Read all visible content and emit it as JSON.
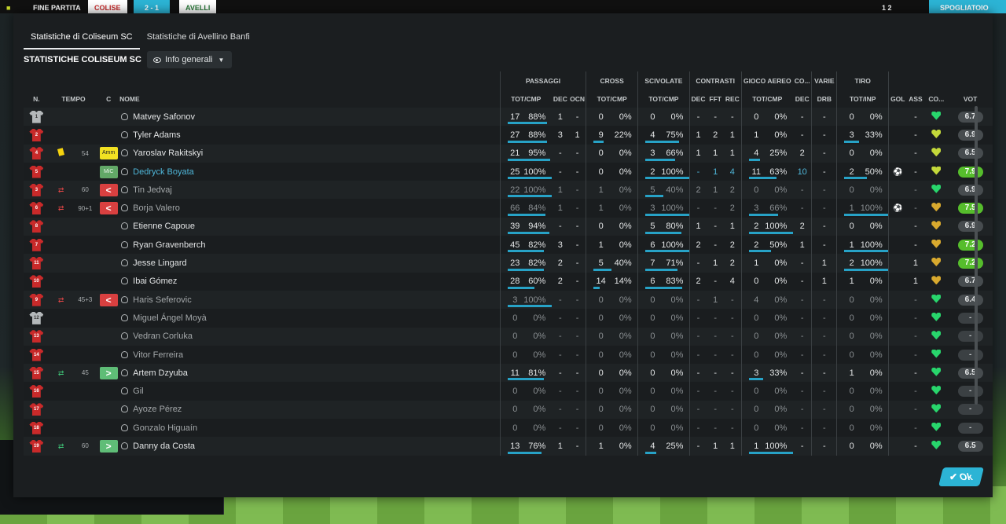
{
  "topbar": {
    "label": "FINE PARTITA",
    "home": "COLISE",
    "score": "2 - 1",
    "away": "AVELLI",
    "right_score": "1 2",
    "right_label": "SPOGLIATOIO"
  },
  "tabs": [
    "Statistiche di Coliseum SC",
    "Statistiche di Avellino Banfi"
  ],
  "team_title": "STATISTICHE COLISEUM SC",
  "view_dropdown": "Info generali",
  "groups": {
    "passaggi": "PASSAGGI",
    "cross": "CROSS",
    "scivolate": "SCIVOLATE",
    "contrasti": "CONTRASTI",
    "aereo": "GIOCO AEREO",
    "co": "CO...",
    "varie": "VARIE",
    "tiro": "TIRO"
  },
  "cols": {
    "n": "N.",
    "tempo": "TEMPO",
    "c": "C",
    "nome": "NOME",
    "totcmp": "TOT/CMP",
    "dec": "DEC",
    "ocn": "OCN",
    "fft": "FFT",
    "rec": "REC",
    "drb": "DRB",
    "totinp": "TOT/INP",
    "gol": "GOL",
    "ass": "ASS",
    "co": "CO...",
    "vot": "VOT"
  },
  "colors": {
    "accent": "#2cb4d5",
    "shirt": "#c92a2a",
    "good_rating": "#56bd2c"
  },
  "players": [
    {
      "num": "1",
      "gk": true,
      "card": "",
      "sub": "",
      "min": "",
      "pos": "",
      "name": "Matvey Safonov",
      "nstyle": "",
      "pas": [
        "17",
        "88%"
      ],
      "pasbar": 0.88,
      "pdec": "1",
      "pocn": "-",
      "cro": [
        "0",
        "0%"
      ],
      "crobar": 0,
      "sci": [
        "0",
        "0%"
      ],
      "scibar": 0,
      "cdec": "-",
      "cfft": "-",
      "crec": "-",
      "aer": [
        "0",
        "0%"
      ],
      "aerbar": 0,
      "codec": "-",
      "vdrb": "-",
      "tiro": [
        "0",
        "0%"
      ],
      "tirobar": 0,
      "gol": "",
      "ass": "-",
      "heart": "g",
      "vot": "6.7",
      "vclass": ""
    },
    {
      "num": "2",
      "gk": false,
      "card": "",
      "sub": "",
      "min": "",
      "pos": "",
      "name": "Tyler Adams",
      "nstyle": "",
      "pas": [
        "27",
        "88%"
      ],
      "pasbar": 0.88,
      "pdec": "3",
      "pocn": "1",
      "cro": [
        "9",
        "22%"
      ],
      "crobar": 0.22,
      "sci": [
        "4",
        "75%"
      ],
      "scibar": 0.75,
      "cdec": "1",
      "cfft": "2",
      "crec": "1",
      "aer": [
        "1",
        "0%"
      ],
      "aerbar": 0,
      "codec": "-",
      "vdrb": "-",
      "tiro": [
        "3",
        "33%"
      ],
      "tirobar": 0.33,
      "gol": "",
      "ass": "-",
      "heart": "y",
      "vot": "6.9",
      "vclass": ""
    },
    {
      "num": "4",
      "gk": false,
      "card": "y",
      "sub": "",
      "min": "54",
      "pos": "amm",
      "posl": "Amm",
      "name": "Yaroslav Rakitskyi",
      "nstyle": "",
      "pas": [
        "21",
        "95%"
      ],
      "pasbar": 0.95,
      "pdec": "-",
      "pocn": "-",
      "cro": [
        "0",
        "0%"
      ],
      "crobar": 0,
      "sci": [
        "3",
        "66%"
      ],
      "scibar": 0.66,
      "cdec": "1",
      "cfft": "1",
      "crec": "1",
      "aer": [
        "4",
        "25%"
      ],
      "aerbar": 0.25,
      "codec": "2",
      "vdrb": "-",
      "tiro": [
        "0",
        "0%"
      ],
      "tirobar": 0,
      "gol": "",
      "ass": "-",
      "heart": "y",
      "vot": "6.5",
      "vclass": ""
    },
    {
      "num": "5",
      "gk": false,
      "card": "",
      "sub": "",
      "min": "",
      "pos": "mic",
      "posl": "MiC",
      "name": "Dedryck Boyata",
      "nstyle": "hl",
      "pas": [
        "25",
        "100%"
      ],
      "pasbar": 1,
      "pdec": "-",
      "pocn": "-",
      "cro": [
        "0",
        "0%"
      ],
      "crobar": 0,
      "sci": [
        "2",
        "100%"
      ],
      "scibar": 1,
      "cdec": "-",
      "cfft": "1",
      "crec": "4",
      "aer": [
        "11",
        "63%"
      ],
      "aerbar": 0.63,
      "codec": "10",
      "vdrb": "-",
      "tiro": [
        "2",
        "50%"
      ],
      "tirobar": 0.5,
      "gol": "ball",
      "ass": "-",
      "heart": "y",
      "vot": "7.9",
      "vclass": "good",
      "hlrow": true
    },
    {
      "num": "3",
      "gk": false,
      "card": "",
      "sub": "off",
      "min": "60",
      "pos": "off",
      "posl": "<",
      "name": "Tin Jedvaj",
      "nstyle": "dim",
      "pas": [
        "22",
        "100%"
      ],
      "pasbar": 1,
      "pdec": "1",
      "pocn": "-",
      "cro": [
        "1",
        "0%"
      ],
      "crobar": 0,
      "sci": [
        "5",
        "40%"
      ],
      "scibar": 0.4,
      "cdec": "2",
      "cfft": "1",
      "crec": "2",
      "aer": [
        "0",
        "0%"
      ],
      "aerbar": 0,
      "codec": "-",
      "vdrb": "-",
      "tiro": [
        "0",
        "0%"
      ],
      "tirobar": 0,
      "gol": "",
      "ass": "-",
      "heart": "g",
      "vot": "6.9",
      "vclass": "",
      "dimrow": true
    },
    {
      "num": "6",
      "gk": false,
      "card": "",
      "sub": "off",
      "min": "90+1",
      "pos": "off",
      "posl": "<",
      "name": "Borja Valero",
      "nstyle": "dim",
      "pas": [
        "66",
        "84%"
      ],
      "pasbar": 0.84,
      "pdec": "1",
      "pocn": "-",
      "cro": [
        "1",
        "0%"
      ],
      "crobar": 0,
      "sci": [
        "3",
        "100%"
      ],
      "scibar": 1,
      "cdec": "-",
      "cfft": "-",
      "crec": "2",
      "aer": [
        "3",
        "66%"
      ],
      "aerbar": 0.66,
      "codec": "-",
      "vdrb": "-",
      "tiro": [
        "1",
        "100%"
      ],
      "tirobar": 1,
      "gol": "ball",
      "ass": "-",
      "heart": "o",
      "vot": "7.5",
      "vclass": "good",
      "dimrow": true
    },
    {
      "num": "8",
      "gk": false,
      "card": "",
      "sub": "",
      "min": "",
      "pos": "",
      "name": "Etienne Capoue",
      "nstyle": "",
      "pas": [
        "39",
        "94%"
      ],
      "pasbar": 0.94,
      "pdec": "-",
      "pocn": "-",
      "cro": [
        "0",
        "0%"
      ],
      "crobar": 0,
      "sci": [
        "5",
        "80%"
      ],
      "scibar": 0.8,
      "cdec": "1",
      "cfft": "-",
      "crec": "1",
      "aer": [
        "2",
        "100%"
      ],
      "aerbar": 1,
      "codec": "2",
      "vdrb": "-",
      "tiro": [
        "0",
        "0%"
      ],
      "tirobar": 0,
      "gol": "",
      "ass": "-",
      "heart": "o",
      "vot": "6.9",
      "vclass": ""
    },
    {
      "num": "7",
      "gk": false,
      "card": "",
      "sub": "",
      "min": "",
      "pos": "",
      "name": "Ryan Gravenberch",
      "nstyle": "",
      "pas": [
        "45",
        "82%"
      ],
      "pasbar": 0.82,
      "pdec": "3",
      "pocn": "-",
      "cro": [
        "1",
        "0%"
      ],
      "crobar": 0,
      "sci": [
        "6",
        "100%"
      ],
      "scibar": 1,
      "cdec": "2",
      "cfft": "-",
      "crec": "2",
      "aer": [
        "2",
        "50%"
      ],
      "aerbar": 0.5,
      "codec": "1",
      "vdrb": "-",
      "tiro": [
        "1",
        "100%"
      ],
      "tirobar": 1,
      "gol": "",
      "ass": "-",
      "heart": "o",
      "vot": "7.2",
      "vclass": "good"
    },
    {
      "num": "11",
      "gk": false,
      "card": "",
      "sub": "",
      "min": "",
      "pos": "",
      "name": "Jesse Lingard",
      "nstyle": "",
      "pas": [
        "23",
        "82%"
      ],
      "pasbar": 0.82,
      "pdec": "2",
      "pocn": "-",
      "cro": [
        "5",
        "40%"
      ],
      "crobar": 0.4,
      "sci": [
        "7",
        "71%"
      ],
      "scibar": 0.71,
      "cdec": "-",
      "cfft": "1",
      "crec": "2",
      "aer": [
        "1",
        "0%"
      ],
      "aerbar": 0,
      "codec": "-",
      "vdrb": "1",
      "tiro": [
        "2",
        "100%"
      ],
      "tirobar": 1,
      "gol": "",
      "ass": "1",
      "heart": "o",
      "vot": "7.2",
      "vclass": "good"
    },
    {
      "num": "10",
      "gk": false,
      "card": "",
      "sub": "",
      "min": "",
      "pos": "",
      "name": "Ibai Gómez",
      "nstyle": "",
      "pas": [
        "28",
        "60%"
      ],
      "pasbar": 0.6,
      "pdec": "2",
      "pocn": "-",
      "cro": [
        "14",
        "14%"
      ],
      "crobar": 0.14,
      "sci": [
        "6",
        "83%"
      ],
      "scibar": 0.83,
      "cdec": "2",
      "cfft": "-",
      "crec": "4",
      "aer": [
        "0",
        "0%"
      ],
      "aerbar": 0,
      "codec": "-",
      "vdrb": "1",
      "tiro": [
        "1",
        "0%"
      ],
      "tirobar": 0,
      "gol": "",
      "ass": "1",
      "heart": "o",
      "vot": "6.7",
      "vclass": ""
    },
    {
      "num": "9",
      "gk": false,
      "card": "",
      "sub": "off",
      "min": "45+3",
      "pos": "off",
      "posl": "<",
      "name": "Haris Seferovic",
      "nstyle": "dim",
      "pas": [
        "3",
        "100%"
      ],
      "pasbar": 1,
      "pdec": "-",
      "pocn": "-",
      "cro": [
        "0",
        "0%"
      ],
      "crobar": 0,
      "sci": [
        "0",
        "0%"
      ],
      "scibar": 0,
      "cdec": "-",
      "cfft": "1",
      "crec": "-",
      "aer": [
        "4",
        "0%"
      ],
      "aerbar": 0,
      "codec": "-",
      "vdrb": "-",
      "tiro": [
        "0",
        "0%"
      ],
      "tirobar": 0,
      "gol": "",
      "ass": "-",
      "heart": "g",
      "vot": "6.4",
      "vclass": "",
      "dimrow": true
    },
    {
      "num": "12",
      "gk": true,
      "card": "",
      "sub": "",
      "min": "",
      "pos": "",
      "name": "Miguel Ángel Moyà",
      "nstyle": "dim",
      "pas": [
        "0",
        "0%"
      ],
      "pasbar": 0,
      "pdec": "-",
      "pocn": "-",
      "cro": [
        "0",
        "0%"
      ],
      "crobar": 0,
      "sci": [
        "0",
        "0%"
      ],
      "scibar": 0,
      "cdec": "-",
      "cfft": "-",
      "crec": "-",
      "aer": [
        "0",
        "0%"
      ],
      "aerbar": 0,
      "codec": "-",
      "vdrb": "-",
      "tiro": [
        "0",
        "0%"
      ],
      "tirobar": 0,
      "gol": "",
      "ass": "-",
      "heart": "g",
      "vot": "-",
      "vclass": "none",
      "dimrow": true
    },
    {
      "num": "13",
      "gk": false,
      "card": "",
      "sub": "",
      "min": "",
      "pos": "",
      "name": "Vedran Corluka",
      "nstyle": "dim",
      "pas": [
        "0",
        "0%"
      ],
      "pasbar": 0,
      "pdec": "-",
      "pocn": "-",
      "cro": [
        "0",
        "0%"
      ],
      "crobar": 0,
      "sci": [
        "0",
        "0%"
      ],
      "scibar": 0,
      "cdec": "-",
      "cfft": "-",
      "crec": "-",
      "aer": [
        "0",
        "0%"
      ],
      "aerbar": 0,
      "codec": "-",
      "vdrb": "-",
      "tiro": [
        "0",
        "0%"
      ],
      "tirobar": 0,
      "gol": "",
      "ass": "-",
      "heart": "g",
      "vot": "-",
      "vclass": "none",
      "dimrow": true
    },
    {
      "num": "14",
      "gk": false,
      "card": "",
      "sub": "",
      "min": "",
      "pos": "",
      "name": "Vitor Ferreira",
      "nstyle": "dim",
      "pas": [
        "0",
        "0%"
      ],
      "pasbar": 0,
      "pdec": "-",
      "pocn": "-",
      "cro": [
        "0",
        "0%"
      ],
      "crobar": 0,
      "sci": [
        "0",
        "0%"
      ],
      "scibar": 0,
      "cdec": "-",
      "cfft": "-",
      "crec": "-",
      "aer": [
        "0",
        "0%"
      ],
      "aerbar": 0,
      "codec": "-",
      "vdrb": "-",
      "tiro": [
        "0",
        "0%"
      ],
      "tirobar": 0,
      "gol": "",
      "ass": "-",
      "heart": "g",
      "vot": "-",
      "vclass": "none",
      "dimrow": true
    },
    {
      "num": "15",
      "gk": false,
      "card": "",
      "sub": "on",
      "min": "45",
      "pos": "in",
      "posl": ">",
      "name": "Artem Dzyuba",
      "nstyle": "",
      "pas": [
        "11",
        "81%"
      ],
      "pasbar": 0.81,
      "pdec": "-",
      "pocn": "-",
      "cro": [
        "0",
        "0%"
      ],
      "crobar": 0,
      "sci": [
        "0",
        "0%"
      ],
      "scibar": 0,
      "cdec": "-",
      "cfft": "-",
      "crec": "-",
      "aer": [
        "3",
        "33%"
      ],
      "aerbar": 0.33,
      "codec": "-",
      "vdrb": "-",
      "tiro": [
        "1",
        "0%"
      ],
      "tirobar": 0,
      "gol": "",
      "ass": "-",
      "heart": "g",
      "vot": "6.5",
      "vclass": ""
    },
    {
      "num": "16",
      "gk": false,
      "card": "",
      "sub": "",
      "min": "",
      "pos": "",
      "name": "Gil",
      "nstyle": "dim",
      "pas": [
        "0",
        "0%"
      ],
      "pasbar": 0,
      "pdec": "-",
      "pocn": "-",
      "cro": [
        "0",
        "0%"
      ],
      "crobar": 0,
      "sci": [
        "0",
        "0%"
      ],
      "scibar": 0,
      "cdec": "-",
      "cfft": "-",
      "crec": "-",
      "aer": [
        "0",
        "0%"
      ],
      "aerbar": 0,
      "codec": "-",
      "vdrb": "-",
      "tiro": [
        "0",
        "0%"
      ],
      "tirobar": 0,
      "gol": "",
      "ass": "-",
      "heart": "g",
      "vot": "-",
      "vclass": "none",
      "dimrow": true
    },
    {
      "num": "17",
      "gk": false,
      "card": "",
      "sub": "",
      "min": "",
      "pos": "",
      "name": "Ayoze Pérez",
      "nstyle": "dim",
      "pas": [
        "0",
        "0%"
      ],
      "pasbar": 0,
      "pdec": "-",
      "pocn": "-",
      "cro": [
        "0",
        "0%"
      ],
      "crobar": 0,
      "sci": [
        "0",
        "0%"
      ],
      "scibar": 0,
      "cdec": "-",
      "cfft": "-",
      "crec": "-",
      "aer": [
        "0",
        "0%"
      ],
      "aerbar": 0,
      "codec": "-",
      "vdrb": "-",
      "tiro": [
        "0",
        "0%"
      ],
      "tirobar": 0,
      "gol": "",
      "ass": "-",
      "heart": "g",
      "vot": "-",
      "vclass": "none",
      "dimrow": true
    },
    {
      "num": "18",
      "gk": false,
      "card": "",
      "sub": "",
      "min": "",
      "pos": "",
      "name": "Gonzalo Higuaín",
      "nstyle": "dim",
      "pas": [
        "0",
        "0%"
      ],
      "pasbar": 0,
      "pdec": "-",
      "pocn": "-",
      "cro": [
        "0",
        "0%"
      ],
      "crobar": 0,
      "sci": [
        "0",
        "0%"
      ],
      "scibar": 0,
      "cdec": "-",
      "cfft": "-",
      "crec": "-",
      "aer": [
        "0",
        "0%"
      ],
      "aerbar": 0,
      "codec": "-",
      "vdrb": "-",
      "tiro": [
        "0",
        "0%"
      ],
      "tirobar": 0,
      "gol": "",
      "ass": "-",
      "heart": "g",
      "vot": "-",
      "vclass": "none",
      "dimrow": true
    },
    {
      "num": "19",
      "gk": false,
      "card": "",
      "sub": "on",
      "min": "60",
      "pos": "in",
      "posl": ">",
      "name": "Danny da Costa",
      "nstyle": "",
      "pas": [
        "13",
        "76%"
      ],
      "pasbar": 0.76,
      "pdec": "1",
      "pocn": "-",
      "cro": [
        "1",
        "0%"
      ],
      "crobar": 0,
      "sci": [
        "4",
        "25%"
      ],
      "scibar": 0.25,
      "cdec": "-",
      "cfft": "1",
      "crec": "1",
      "aer": [
        "1",
        "100%"
      ],
      "aerbar": 1,
      "codec": "-",
      "vdrb": "-",
      "tiro": [
        "0",
        "0%"
      ],
      "tirobar": 0,
      "gol": "",
      "ass": "-",
      "heart": "g",
      "vot": "6.5",
      "vclass": ""
    }
  ],
  "ok_label": "Ok"
}
